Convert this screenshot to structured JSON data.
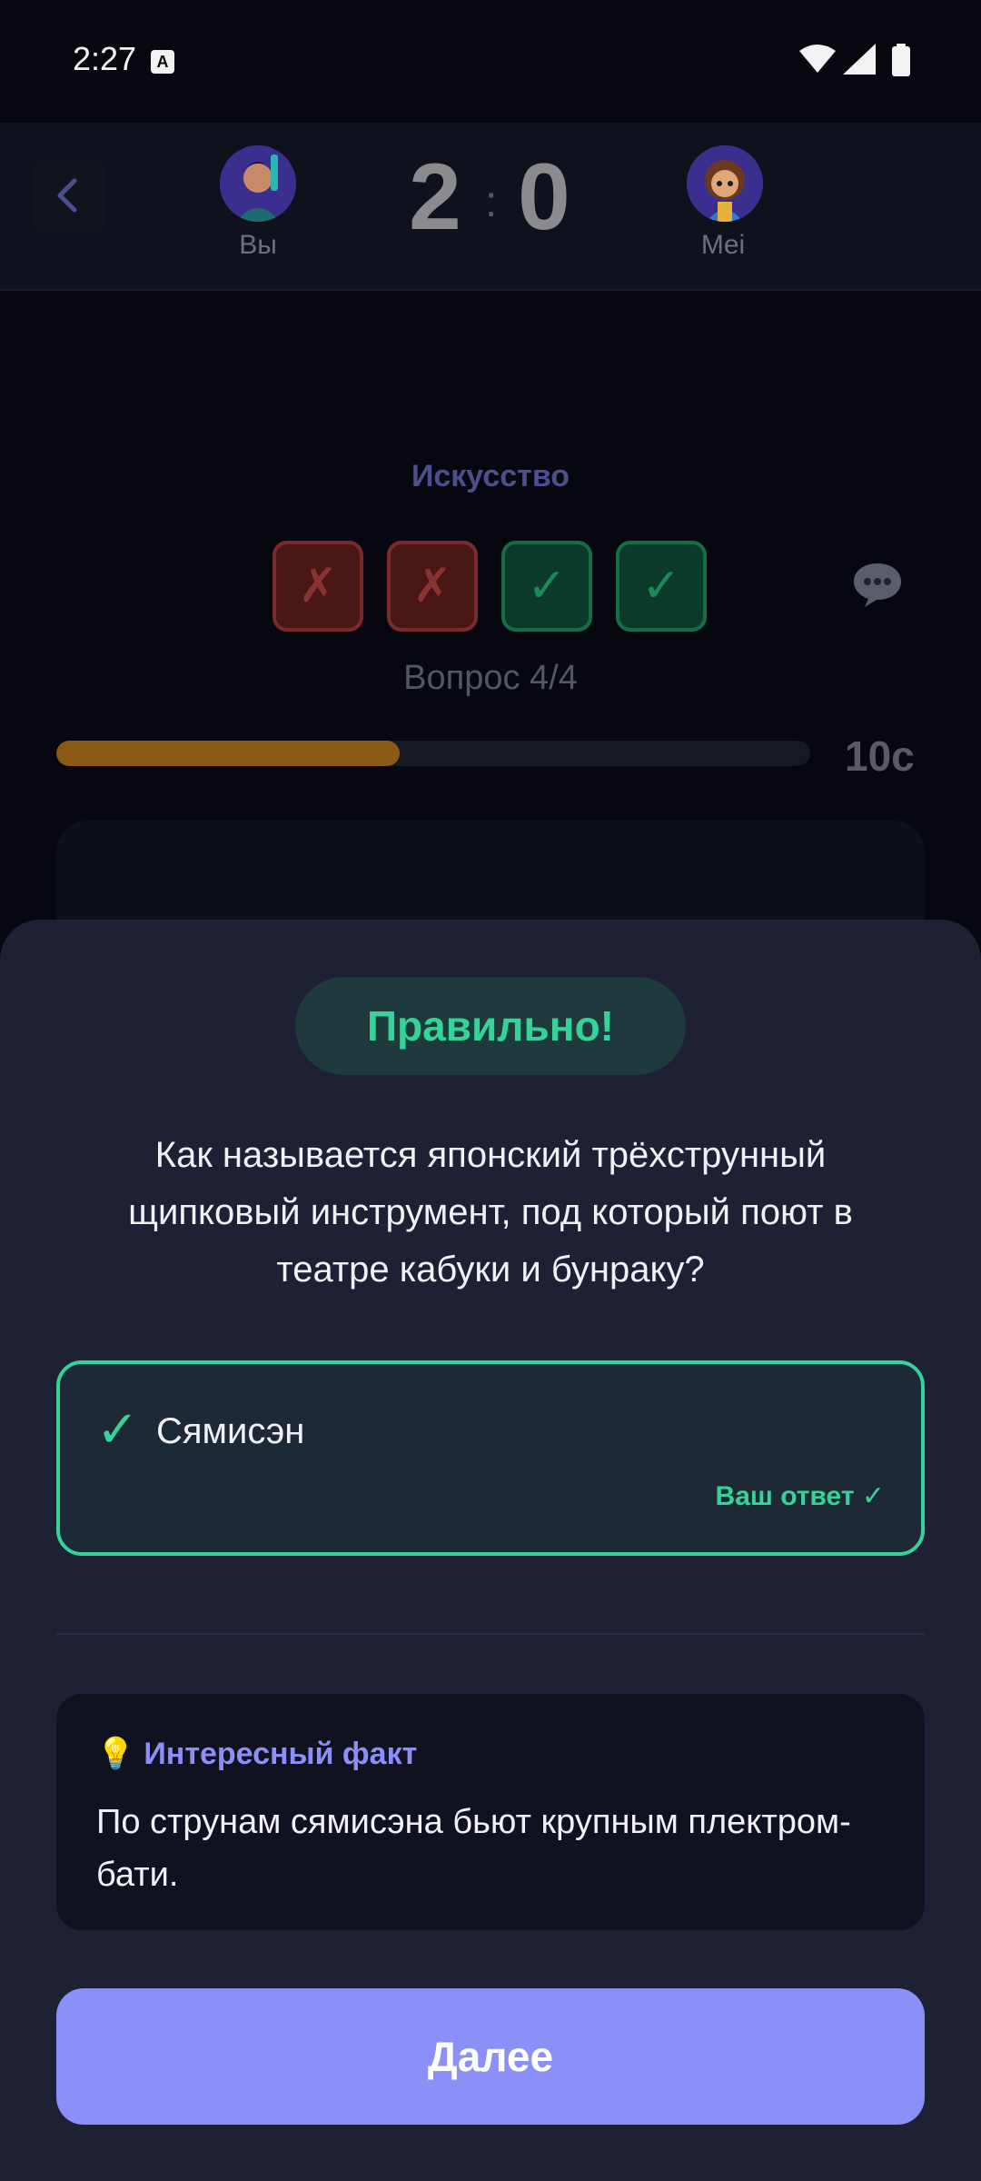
{
  "status_bar": {
    "time": "2:27",
    "notification_glyph": "A"
  },
  "header": {
    "player_you": {
      "name": "Вы",
      "score": "2"
    },
    "score_separator": ":",
    "player_opponent": {
      "name": "Mei",
      "score": "0"
    }
  },
  "quiz": {
    "category": "Искусство",
    "progress": [
      {
        "status": "wrong",
        "symbol": "✗"
      },
      {
        "status": "wrong",
        "symbol": "✗"
      },
      {
        "status": "correct",
        "symbol": "✓"
      },
      {
        "status": "correct",
        "symbol": "✓"
      }
    ],
    "question_number": "Вопрос 4/4",
    "timer_text": "10с",
    "timer_fraction": 0.455
  },
  "result": {
    "title": "Правильно!",
    "question": "Как называется японский трёхструнный щипковый инструмент, под который поют в театре кабуки и бунраку?",
    "answer": {
      "check": "✓",
      "label": "Сямисэн",
      "your_answer": "Ваш ответ ✓"
    },
    "fact": {
      "icon": "💡",
      "title": "Интересный факт",
      "text": "По струнам сямисэна бьют крупным плектром-бати."
    },
    "next_button": "Далее"
  },
  "colors": {
    "background": "#07080f",
    "sheet": "#1e2033",
    "correct": "#34d399",
    "accent": "#8b8ff8",
    "timer": "#8a5a14"
  }
}
